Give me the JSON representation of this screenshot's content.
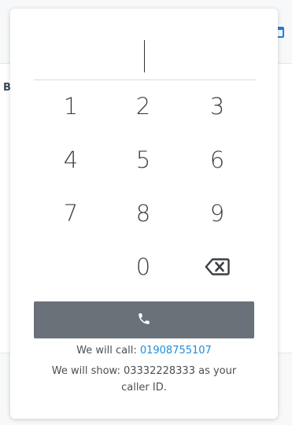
{
  "background": {
    "partial_letter": "B"
  },
  "dialpad": {
    "input_value": "",
    "keys": [
      "1",
      "2",
      "3",
      "4",
      "5",
      "6",
      "7",
      "8",
      "9",
      "0"
    ]
  },
  "info": {
    "call_prefix": "We will call: ",
    "call_number": "01908755107",
    "show_line1": "We will show: 03332228333 as your",
    "show_line2": "caller ID."
  },
  "colors": {
    "call_button": "#6b7178",
    "link": "#1e8ed8",
    "text": "#3a3f45"
  },
  "icons": {
    "call_button": "phone-icon",
    "backspace": "backspace-icon",
    "background_top_right": "calendar-icon"
  }
}
